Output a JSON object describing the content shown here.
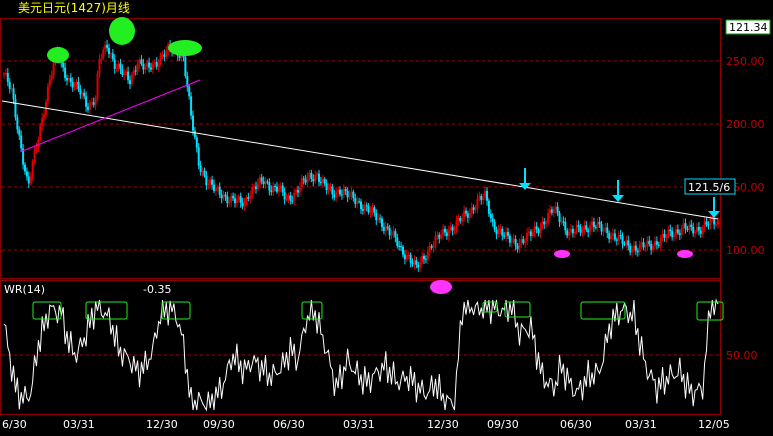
{
  "header": {
    "title": "美元日元(1427)月线"
  },
  "colors": {
    "background": "#000000",
    "frame": "#8a0000",
    "grid": "#a00000",
    "axis_label": "#c00000",
    "up_candle": "#e00000",
    "down_candle": "#00e0ff",
    "trendline_long": "#ffffff",
    "trendline_short": "#ff00ff",
    "peak_marker": "#22ee22",
    "trough_marker": "#ff33ff",
    "arrow": "#00e0ff",
    "wr_line": "#ffffff",
    "wr_box": "#22ee22",
    "title_text": "#ffff00",
    "price_box_bg": "#ffffff",
    "price_box_text": "#000000",
    "price_tag_bg": "#000000",
    "price_tag_border": "#00e0ff",
    "date_text": "#ffffff"
  },
  "main_panel": {
    "current_price_label": "121.34",
    "last_price_tag": "121.5/6",
    "y_tick_labels": [
      "250.00",
      "200.00",
      "150.00",
      "100.00"
    ]
  },
  "wr_panel": {
    "label": "WR(14)",
    "value": "-0.35",
    "y_tick_labels": [
      "50.00"
    ]
  },
  "x_axis": {
    "tick_labels": [
      "6/30",
      "03/31",
      "12/30",
      "09/30",
      "06/30",
      "03/31",
      "12/30",
      "09/30",
      "06/30",
      "03/31",
      "12/05"
    ]
  },
  "chart_data": [
    {
      "type": "candlestick",
      "title": "美元日元(1427)月线",
      "ylabel": "",
      "xlabel": "",
      "y_ticks": [
        100,
        150,
        200,
        250
      ],
      "ylim": [
        75,
        265
      ],
      "grid": true,
      "price_anchors": {
        "index": [
          0,
          4,
          8,
          12,
          13,
          16,
          20,
          24,
          28,
          30,
          34,
          40,
          44,
          48,
          50,
          54,
          58,
          62,
          66,
          70,
          74,
          78,
          82,
          86,
          90,
          94,
          98,
          102,
          106,
          110,
          114,
          118,
          122,
          126,
          128,
          132,
          136,
          140,
          144,
          148,
          152,
          156,
          160,
          164,
          168,
          172,
          176,
          180,
          184,
          188,
          192,
          196,
          200,
          204,
          208,
          212,
          216,
          220,
          224,
          228,
          232,
          236,
          240,
          244,
          248,
          252,
          256,
          260,
          264,
          268,
          272,
          276,
          280,
          284,
          288,
          292,
          296,
          300,
          304,
          308,
          312,
          316,
          320,
          324,
          328,
          332,
          336,
          340,
          344,
          348,
          352,
          356,
          360,
          364,
          368,
          372,
          374
        ],
        "value": [
          240,
          225,
          190,
          155,
          152,
          175,
          205,
          235,
          258,
          247,
          235,
          225,
          215,
          220,
          250,
          263,
          248,
          240,
          235,
          250,
          243,
          247,
          253,
          258,
          260,
          253,
          205,
          170,
          155,
          148,
          145,
          140,
          138,
          138,
          145,
          150,
          155,
          150,
          148,
          140,
          145,
          152,
          158,
          160,
          150,
          145,
          148,
          143,
          140,
          135,
          130,
          125,
          118,
          110,
          100,
          95,
          85,
          94,
          105,
          110,
          115,
          120,
          125,
          130,
          140,
          142,
          120,
          115,
          108,
          105,
          108,
          112,
          118,
          125,
          132,
          124,
          113,
          115,
          118,
          120,
          117,
          115,
          110,
          106,
          103,
          101,
          103,
          105,
          108,
          112,
          115,
          118,
          115,
          117,
          121,
          121.5,
          121.34
        ]
      },
      "last_price": "121.5/6",
      "current_price": 121.34
    },
    {
      "type": "line",
      "title": "WR(14)",
      "value": -0.35,
      "ylim": [
        0,
        100
      ],
      "y_ticks": [
        50
      ],
      "grid": true,
      "levels_index": [
        0,
        6,
        10,
        14,
        18,
        24,
        30,
        34,
        38,
        42,
        48,
        52,
        56,
        60,
        66,
        70,
        74,
        78,
        82,
        86,
        90,
        94,
        98,
        102,
        108,
        114,
        120,
        126,
        130,
        134,
        140,
        146,
        150,
        154,
        158,
        162,
        168,
        174,
        180,
        186,
        190,
        196,
        200,
        206,
        212,
        218,
        222,
        226,
        230,
        236,
        240,
        244,
        248,
        252,
        258,
        262,
        266,
        270,
        276,
        282,
        288,
        292,
        296,
        300,
        306,
        312,
        318,
        324,
        330,
        336,
        342,
        348,
        354,
        360,
        366,
        370,
        374
      ],
      "levels_value": [
        78,
        20,
        10,
        15,
        60,
        92,
        88,
        60,
        50,
        65,
        93,
        90,
        80,
        55,
        45,
        35,
        40,
        55,
        88,
        92,
        88,
        60,
        5,
        8,
        5,
        20,
        50,
        35,
        45,
        40,
        30,
        40,
        55,
        45,
        80,
        92,
        60,
        20,
        45,
        30,
        25,
        35,
        40,
        25,
        30,
        18,
        15,
        25,
        10,
        5,
        92,
        95,
        90,
        95,
        92,
        90,
        95,
        70,
        75,
        30,
        20,
        40,
        25,
        15,
        30,
        35,
        80,
        92,
        85,
        40,
        20,
        30,
        35,
        15,
        20,
        95,
        99
      ]
    }
  ]
}
